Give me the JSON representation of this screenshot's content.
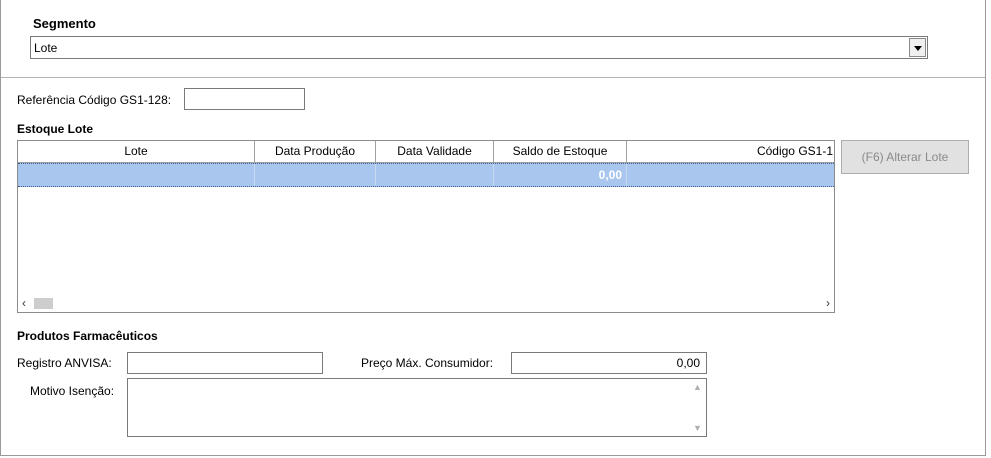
{
  "segmento": {
    "title": "Segmento",
    "selected": "Lote"
  },
  "referencia": {
    "label": "Referência Código GS1-128:",
    "value": ""
  },
  "estoque": {
    "title": "Estoque Lote",
    "columns": [
      "Lote",
      "Data Produção",
      "Data Validade",
      "Saldo de Estoque",
      "Código GS1-1"
    ],
    "rows": [
      {
        "lote": "",
        "data_producao": "",
        "data_validade": "",
        "saldo": "0,00",
        "codigo": ""
      }
    ]
  },
  "alterar_button": "(F6) Alterar Lote",
  "farmaceuticos": {
    "title": "Produtos Farmacêuticos",
    "registro_label": "Registro ANVISA:",
    "registro_value": "",
    "preco_label": "Preço Máx. Consumidor:",
    "preco_value": "0,00",
    "motivo_label": "Motivo Isenção:",
    "motivo_value": ""
  }
}
